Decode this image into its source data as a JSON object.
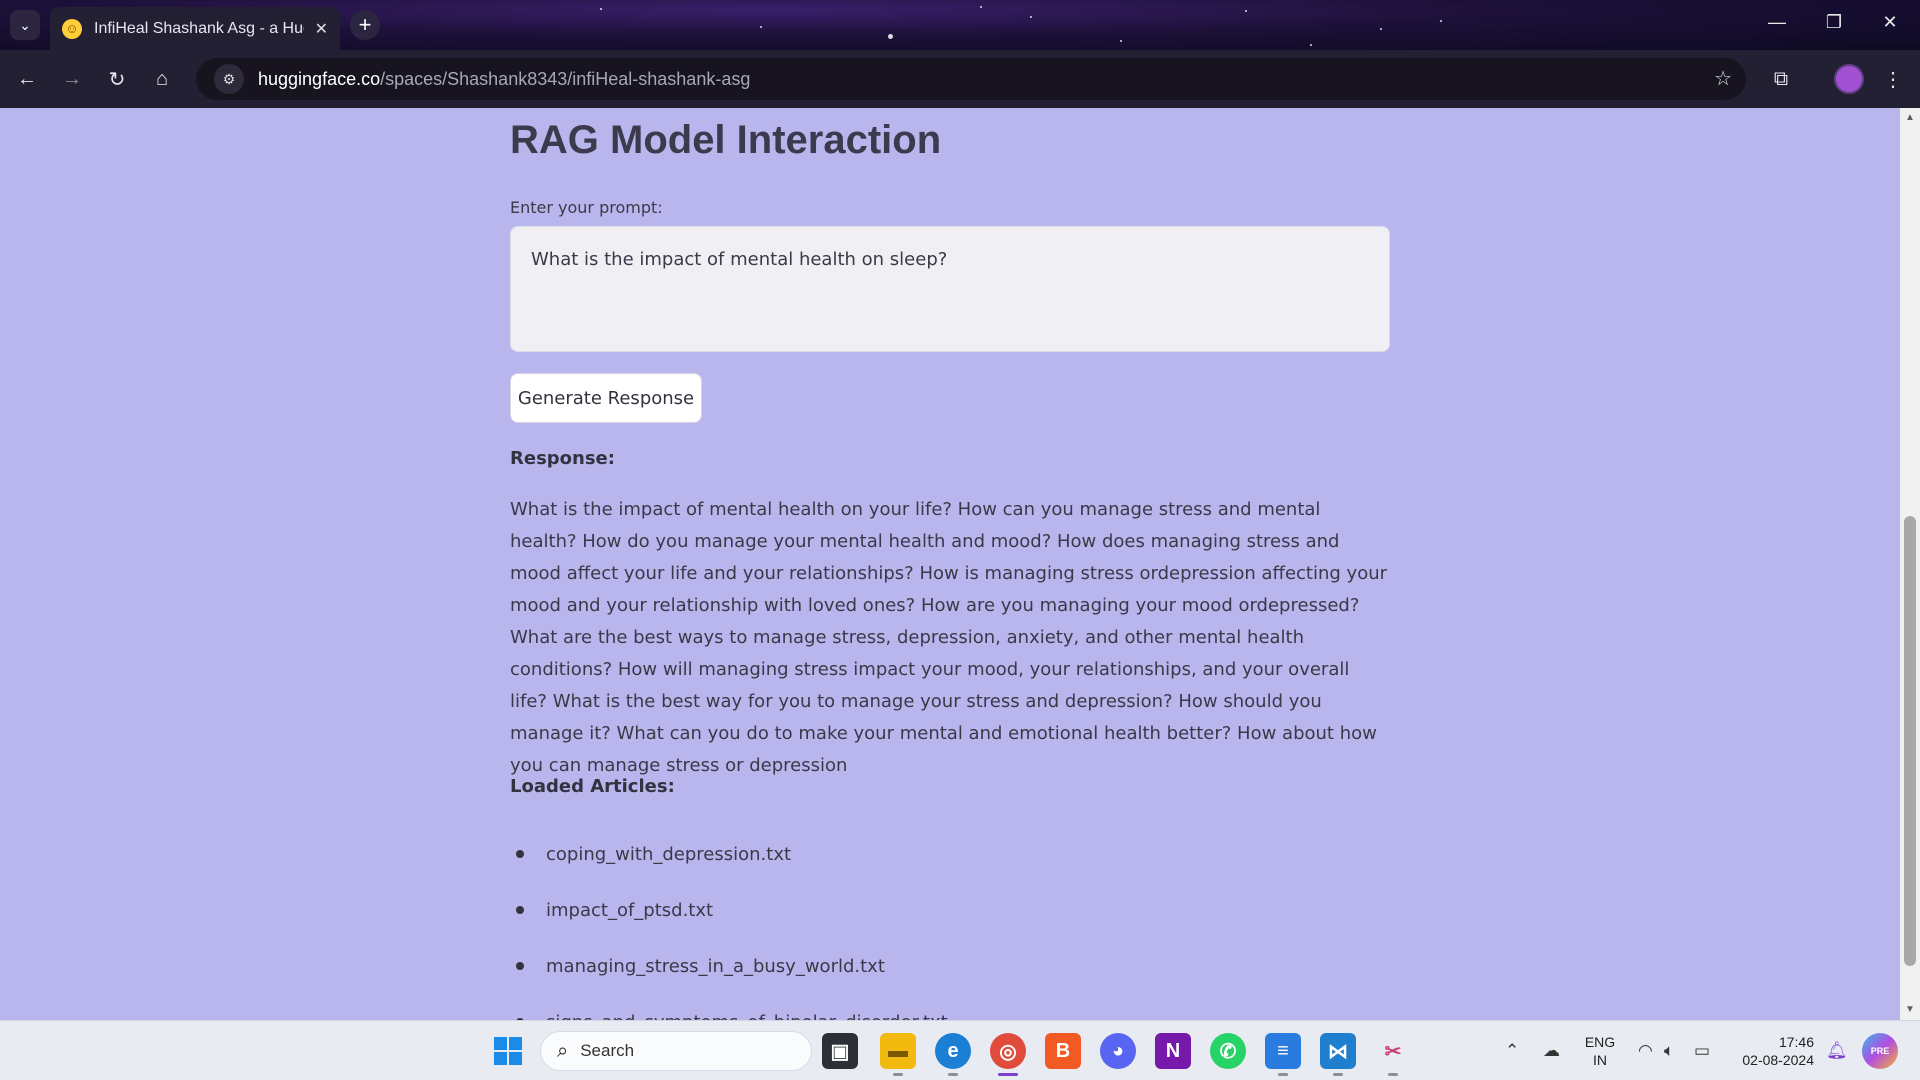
{
  "browser": {
    "tab_title": "InfiHeal Shashank Asg - a Hugg",
    "tab_close": "✕",
    "new_tab": "+",
    "url_domain": "huggingface.co",
    "url_path": "/spaces/Shashank8343/infiHeal-shashank-asg",
    "accent_color": "#232033"
  },
  "page": {
    "title": "RAG Model Interaction",
    "prompt_label": "Enter your prompt:",
    "prompt_value": "What is the impact of mental health on sleep?",
    "generate_button": "Generate Response",
    "response_heading": "Response:",
    "response_text": "What is the impact of mental health on your life? How can you manage stress and mental health? How do you manage your mental health and mood? How does managing stress and mood affect your life and your relationships? How is managing stress ordepression affecting your mood and your relationship with loved ones? How are you managing your mood ordepressed? What are the best ways to manage stress, depression, anxiety, and other mental health conditions? How will managing stress impact your mood, your relationships, and your overall life? What is the best way for you to manage your stress and depression? How should you manage it? What can you do to make your mental and emotional health better? How about how you can manage stress or depression",
    "articles_heading": "Loaded Articles:",
    "articles": [
      "coping_with_depression.txt",
      "impact_of_ptsd.txt",
      "managing_stress_in_a_busy_world.txt",
      "signs_and_symptoms_of_bipolar_disorder.txt"
    ],
    "background_color": "#b9b6ee"
  },
  "taskbar": {
    "search_placeholder": "Search",
    "language_line1": "ENG",
    "language_line2": "IN",
    "time": "17:46",
    "date": "02-08-2024"
  }
}
